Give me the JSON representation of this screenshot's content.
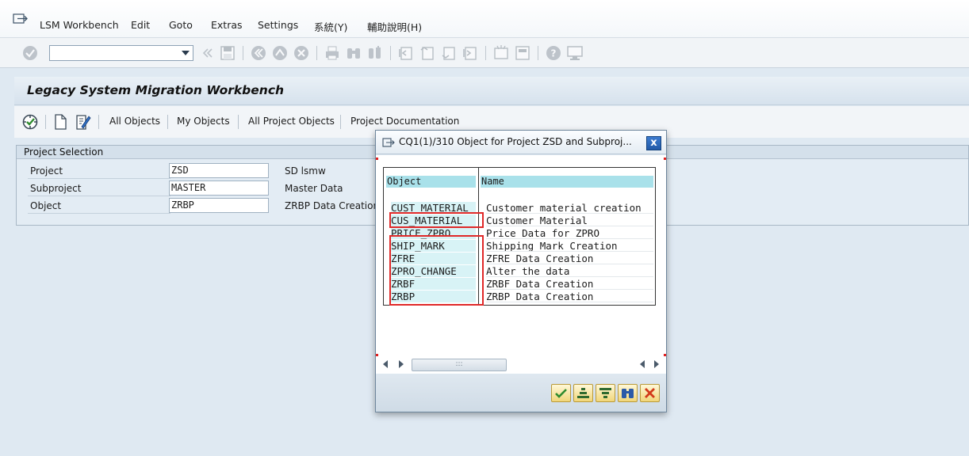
{
  "menubar": {
    "items": [
      "LSM Workbench",
      "Edit",
      "Goto",
      "Extras",
      "Settings",
      "系統(Y)",
      "輔助說明(H)"
    ]
  },
  "toolbar": {
    "command_field_value": ""
  },
  "title": "Legacy System Migration Workbench",
  "app_toolbar": {
    "buttons": [
      "All Objects",
      "My Objects",
      "All Project Objects",
      "Project Documentation"
    ]
  },
  "project_selection": {
    "heading": "Project Selection",
    "fields": [
      {
        "label": "Project",
        "value": "ZSD",
        "description": "SD lsmw"
      },
      {
        "label": "Subproject",
        "value": "MASTER",
        "description": "Master Data"
      },
      {
        "label": "Object",
        "value": "ZRBP",
        "description": "ZRBP Data Creation"
      }
    ]
  },
  "dialog": {
    "title": "CQ1(1)/310 Object for Project ZSD and Subproj...",
    "close_label": "x",
    "columns": [
      "Object",
      "Name"
    ],
    "rows": [
      {
        "object": "CUST_MATERIAL",
        "name": "Customer material creation"
      },
      {
        "object": "CUS_MATERIAL",
        "name": "Customer Material"
      },
      {
        "object": "PRICE_ZPRO",
        "name": "Price Data for ZPRO"
      },
      {
        "object": "SHIP_MARK",
        "name": "Shipping Mark Creation"
      },
      {
        "object": "ZFRE",
        "name": "ZFRE Data Creation"
      },
      {
        "object": "ZPRO_CHANGE",
        "name": "Alter the data"
      },
      {
        "object": "ZRBF",
        "name": "ZRBF Data Creation"
      },
      {
        "object": "ZRBP",
        "name": "ZRBP Data Creation"
      }
    ],
    "scroll_grip": ":::",
    "footer_buttons": [
      "continue-icon",
      "sort-ascending-icon",
      "filter-icon",
      "find-icon",
      "cancel-icon"
    ]
  },
  "colors": {
    "background": "#dfe9f2",
    "highlight_border": "#e02828",
    "cell_highlight": "#d8f3f6",
    "header_cell": "#a9e1ea",
    "close_button": "#215aa7"
  }
}
